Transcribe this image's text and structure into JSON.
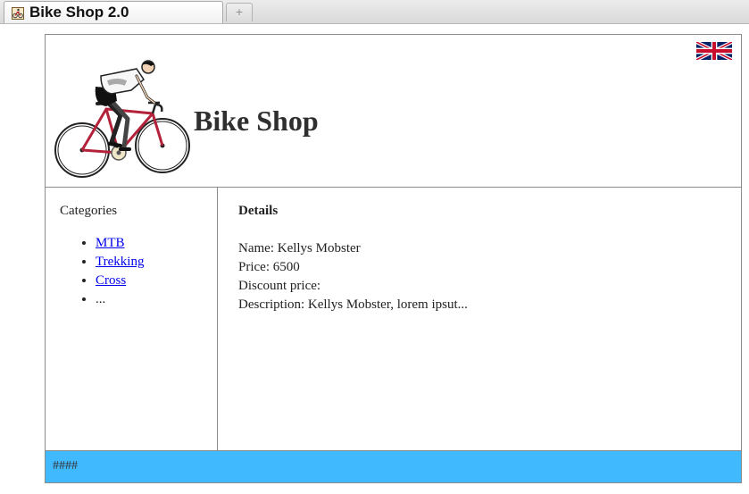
{
  "browser": {
    "tab_title": "Bike Shop 2.0",
    "new_tab_symbol": "+"
  },
  "header": {
    "title": "Bike Shop",
    "language_flag": "uk-flag-icon"
  },
  "sidebar": {
    "heading": "Categories",
    "items": [
      {
        "label": "MTB",
        "link": true
      },
      {
        "label": "Trekking",
        "link": true
      },
      {
        "label": "Cross",
        "link": true
      },
      {
        "label": "...",
        "link": false
      }
    ]
  },
  "details": {
    "heading": "Details",
    "lines": [
      "Name: Kellys Mobster",
      "Price: 6500",
      "Discount price:",
      "Description: Kellys Mobster, lorem ipsut..."
    ]
  },
  "footer": {
    "text": "####",
    "background": "#40b9ff"
  }
}
